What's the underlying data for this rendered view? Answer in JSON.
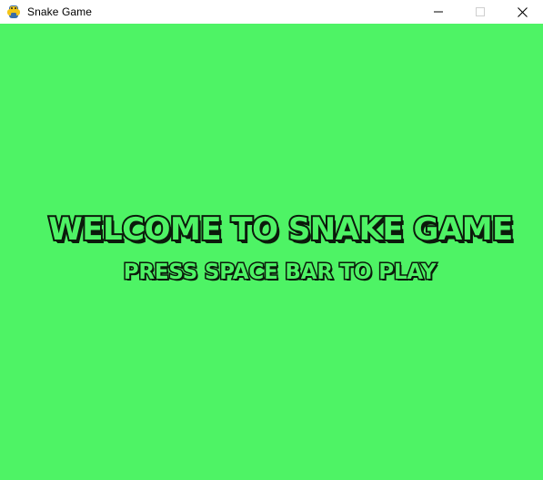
{
  "window": {
    "title": "Snake Game",
    "app_icon": "python-snake-icon",
    "controls": {
      "minimize": "minimize-icon",
      "maximize": "maximize-icon",
      "close": "close-icon"
    }
  },
  "game": {
    "background_color": "#4ef365",
    "text_outline_color": "#0b1a0b",
    "title": "WELCOME TO SNAKE GAME",
    "prompt": "PRESS SPACE BAR TO PLAY"
  }
}
